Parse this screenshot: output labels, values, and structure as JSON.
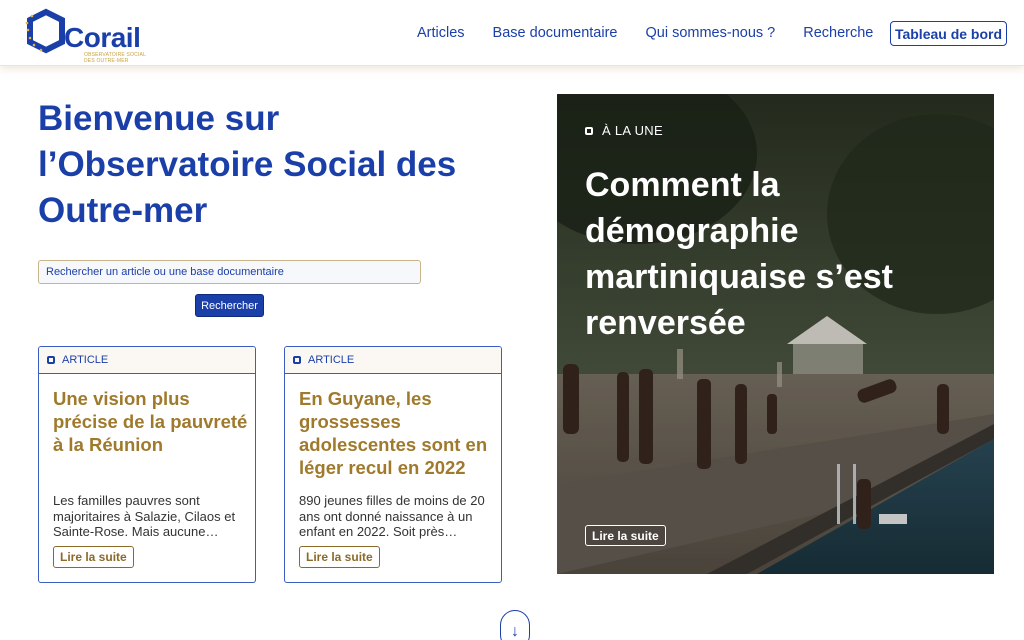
{
  "header": {
    "logo_text": "Corail",
    "logo_subtitle": "OBSERVATOIRE SOCIAL DES OUTRE-MER",
    "nav": [
      "Articles",
      "Base documentaire",
      "Qui sommes-nous ?",
      "Recherche"
    ],
    "dashboard_label": "Tableau de bord"
  },
  "hero": {
    "title": "Bienvenue sur l’Observatoire Social des Outre-mer",
    "search_placeholder": "Rechercher un article ou une base documentaire",
    "search_button": "Rechercher"
  },
  "cards": [
    {
      "tag": "ARTICLE",
      "title": "Une vision plus précise de la pauvreté à la Réunion",
      "excerpt": "Les familles pauvres sont majoritaires à Salazie, Cilaos et Sainte-Rose. Mais aucune…",
      "more": "Lire la suite"
    },
    {
      "tag": "ARTICLE",
      "title": "En Guyane, les grossesses adolescentes sont en léger recul en 2022",
      "excerpt": "890 jeunes filles de moins de 20 ans ont donné naissance à un enfant en 2022. Soit près…",
      "more": "Lire la suite"
    }
  ],
  "featured": {
    "tag": "À LA UNE",
    "title": "Comment la démographie martiniquaise s’est renversée",
    "more": "Lire la suite"
  },
  "colors": {
    "brand_blue": "#1b3fa8",
    "accent_gold": "#a07a2c"
  },
  "icons": {
    "tag": "square-tag-icon",
    "scroll": "arrow-down-icon"
  },
  "scroll_arrow": "↓"
}
